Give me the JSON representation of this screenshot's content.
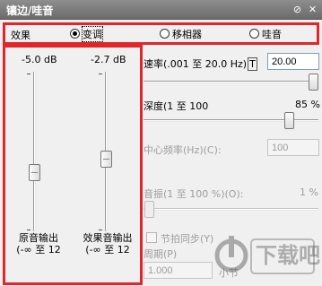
{
  "window": {
    "title": "镶边/哇音",
    "buttons": [
      "help-icon",
      "close-icon"
    ]
  },
  "effect": {
    "label": "效果",
    "options": [
      {
        "label": "变调",
        "selected": true
      },
      {
        "label": "移相器",
        "selected": false
      },
      {
        "label": "哇音",
        "selected": false
      }
    ]
  },
  "mixer": {
    "original": {
      "db": "-5.0 dB",
      "label_line1": "原音输出",
      "label_line2": "(-∞ 至 12"
    },
    "effect": {
      "db": "-2.7 dB",
      "label_line1": "效果音输出",
      "label_line2": "(-∞ 至 12"
    }
  },
  "params": {
    "rate": {
      "label": "速率(.001 至 20.0 Hz)",
      "shortcut": "T",
      "value": "20.00"
    },
    "depth": {
      "label": "深度(1 至 100",
      "value": "85 %"
    },
    "center_freq": {
      "label": "中心频率(Hz)(C):",
      "value": "100"
    },
    "amplitude": {
      "label": "音振(1 至 100 %)(O):",
      "value": "1 %"
    },
    "sync": {
      "label": "节拍同步(Y)",
      "checked": false
    },
    "period": {
      "label": "周期(P)",
      "value": "1.000",
      "unit": "小节"
    }
  },
  "watermark": {
    "text": "下载吧"
  },
  "colors": {
    "highlight": "#e0262b",
    "title_bar": "#7a7a7a"
  }
}
